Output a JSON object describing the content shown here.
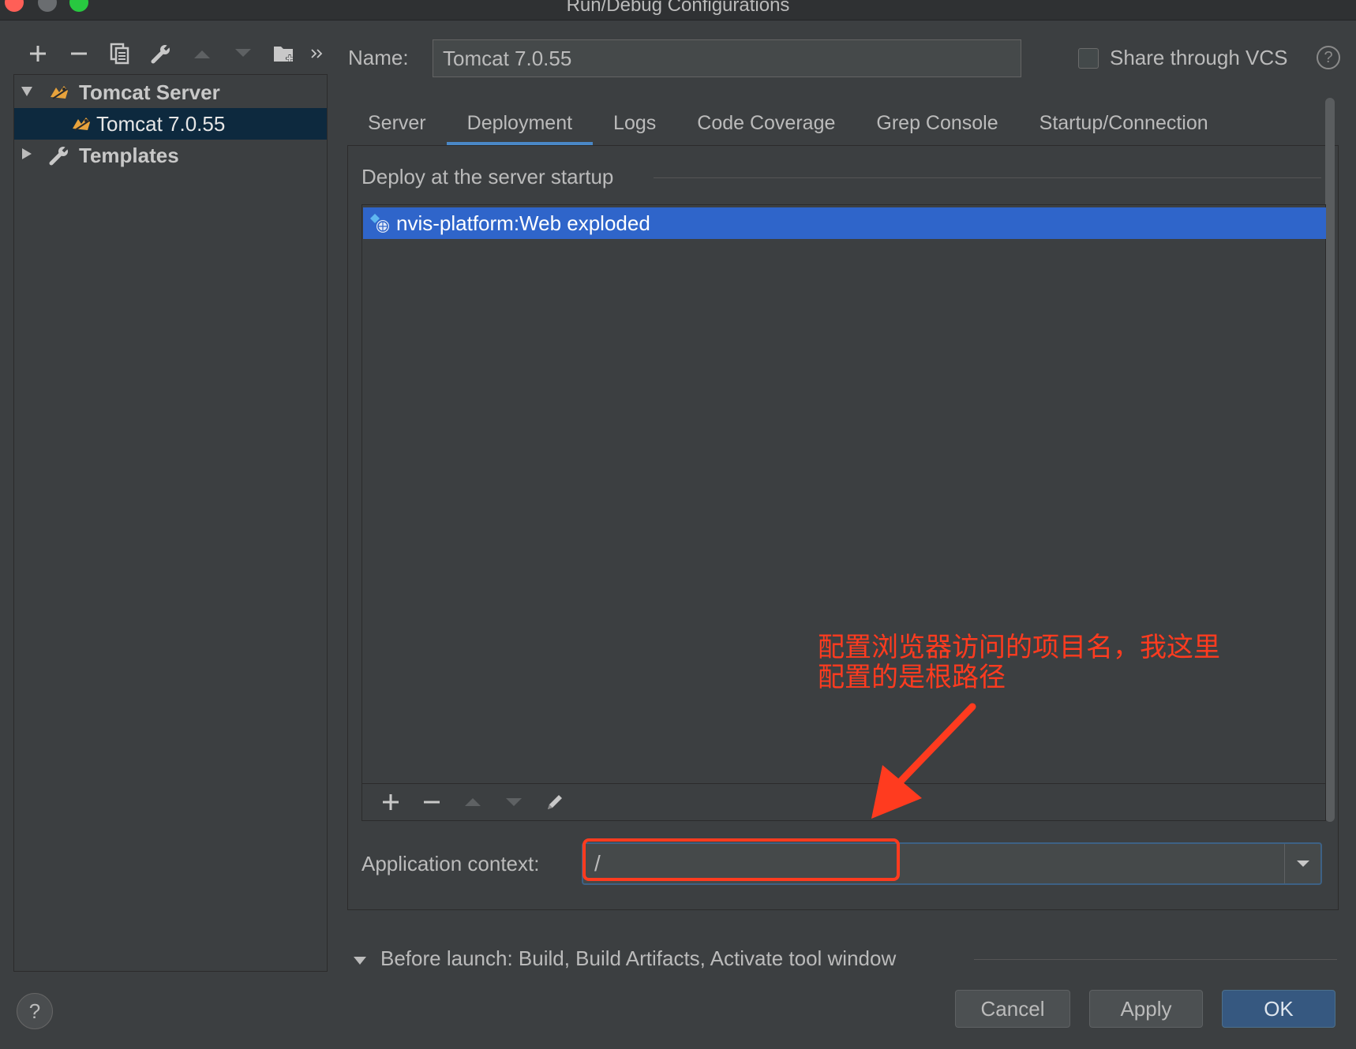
{
  "window": {
    "title": "Run/Debug Configurations"
  },
  "left_toolbar": {
    "icons": [
      "add-icon",
      "remove-icon",
      "copy-icon",
      "wrench-icon",
      "move-up-icon",
      "move-down-icon",
      "folder-add-icon",
      "more-icon"
    ]
  },
  "tree": {
    "group_label": "Tomcat Server",
    "child_label": "Tomcat 7.0.55",
    "templates_label": "Templates"
  },
  "config": {
    "name_label": "Name:",
    "name_value": "Tomcat 7.0.55",
    "share_vcs_label": "Share through VCS",
    "share_vcs_checked": false
  },
  "tabs": [
    {
      "label": "Server",
      "active": false
    },
    {
      "label": "Deployment",
      "active": true
    },
    {
      "label": "Logs",
      "active": false
    },
    {
      "label": "Code Coverage",
      "active": false
    },
    {
      "label": "Grep Console",
      "active": false
    },
    {
      "label": "Startup/Connection",
      "active": false
    }
  ],
  "deployment": {
    "section_title": "Deploy at the server startup",
    "items": [
      "nvis-platform:Web exploded"
    ],
    "selected_index": 0,
    "app_context_label": "Application context:",
    "app_context_value": "/"
  },
  "annotation": {
    "line1": "配置浏览器访问的项目名，我这里",
    "line2": "配置的是根路径",
    "color": "#ff3b1f"
  },
  "before_launch": {
    "label": "Before launch: Build, Build Artifacts, Activate tool window"
  },
  "footer": {
    "help_label": "?",
    "cancel_label": "Cancel",
    "apply_label": "Apply",
    "ok_label": "OK"
  },
  "colors": {
    "background": "#3c3f41",
    "selection": "#2f65ca",
    "tab_underline": "#4a88c7",
    "ok_button": "#365880"
  }
}
